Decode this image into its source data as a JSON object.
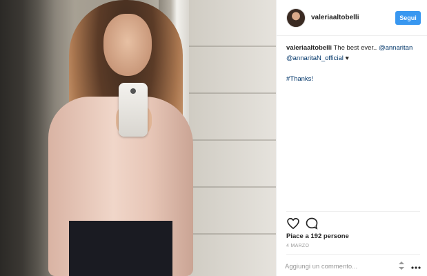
{
  "post": {
    "username": "valeriaaltobelli",
    "follow_label": "Segui",
    "caption": {
      "username": "valeriaaltobelli",
      "text": " The best ever.. ",
      "mention1": "@annaritan",
      "mention2": "@annaritaN_official",
      "heart": "♥",
      "hashtag": "#Thanks!"
    },
    "likes": "Piace a 192 persone",
    "date": "4 MARZO",
    "comment_placeholder": "Aggiungi un commento..."
  },
  "icons": {
    "like": "heart-outline-icon",
    "comment": "speech-bubble-icon",
    "stepper": "up-down-arrows-icon",
    "more": "more-dots-icon"
  },
  "colors": {
    "follow_button": "#3897f0",
    "link": "#003569",
    "muted": "#999999"
  }
}
